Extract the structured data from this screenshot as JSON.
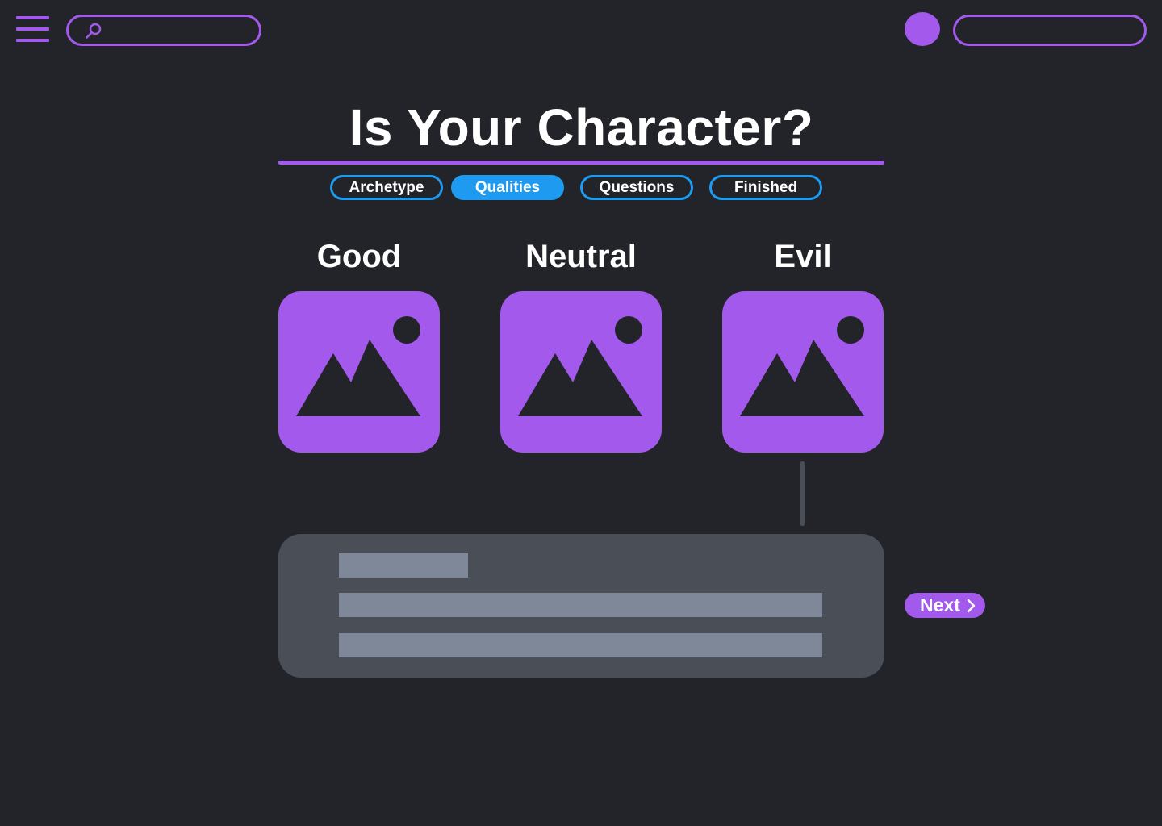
{
  "header": {
    "search_placeholder": "",
    "icons": {
      "menu": "hamburger-menu-icon",
      "search": "search-icon",
      "avatar": "user-avatar"
    }
  },
  "page": {
    "title": "Is Your Character?"
  },
  "steps": [
    {
      "label": "Archetype",
      "active": false
    },
    {
      "label": "Qualities",
      "active": true
    },
    {
      "label": "Questions",
      "active": false
    },
    {
      "label": "Finished",
      "active": false
    }
  ],
  "choices": [
    {
      "label": "Good",
      "icon": "image-placeholder-icon"
    },
    {
      "label": "Neutral",
      "icon": "image-placeholder-icon"
    },
    {
      "label": "Evil",
      "icon": "image-placeholder-icon"
    }
  ],
  "actions": {
    "next_label": "Next",
    "next_icon": "chevron-right-icon"
  },
  "colors": {
    "background": "#232429",
    "accent": "#a259ec",
    "step_accent": "#1e9bf0",
    "panel": "#4a4e57",
    "placeholder_bar": "#7f8898"
  }
}
